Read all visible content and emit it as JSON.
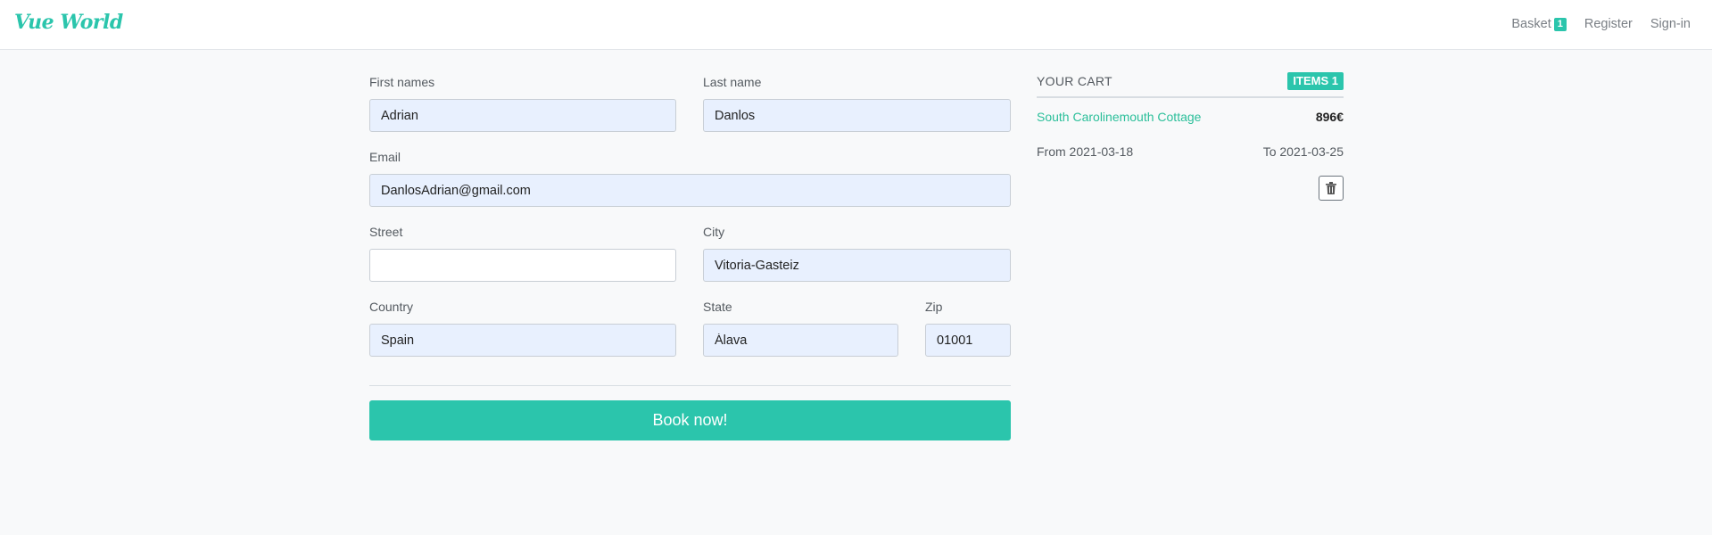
{
  "nav": {
    "brand": "Vue World",
    "basket_label": "Basket",
    "basket_count": "1",
    "register": "Register",
    "signin": "Sign-in"
  },
  "form": {
    "first_name": {
      "label": "First names",
      "value": "Adrian"
    },
    "last_name": {
      "label": "Last name",
      "value": "Danlos"
    },
    "email": {
      "label": "Email",
      "value": "DanlosAdrian@gmail.com"
    },
    "street": {
      "label": "Street",
      "value": ""
    },
    "city": {
      "label": "City",
      "value": "Vitoria-Gasteiz"
    },
    "country": {
      "label": "Country",
      "value": "Spain"
    },
    "state": {
      "label": "State",
      "value": "Álava"
    },
    "zip": {
      "label": "Zip",
      "value": "01001"
    },
    "submit": "Book now!"
  },
  "cart": {
    "title": "YOUR CART",
    "items_badge": "ITEMS 1",
    "item": {
      "name": "South Carolinemouth Cottage",
      "price": "896€",
      "from": "From 2021-03-18",
      "to": "To 2021-03-25"
    },
    "delete_icon": "trash-icon"
  },
  "colors": {
    "accent": "#2bc5ac",
    "input_fill": "#e8f0fe",
    "background": "#f8f9fa"
  }
}
